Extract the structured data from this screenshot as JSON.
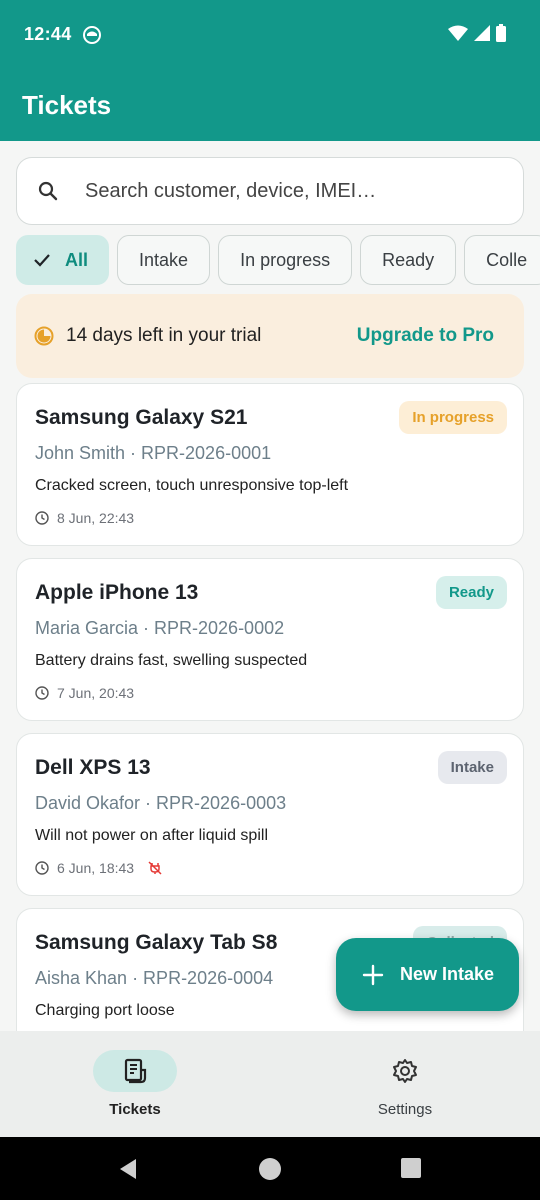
{
  "status_bar": {
    "time": "12:44"
  },
  "app_bar": {
    "title": "Tickets"
  },
  "search": {
    "placeholder": "Search customer, device, IMEI…"
  },
  "filters": [
    {
      "label": "All",
      "selected": true
    },
    {
      "label": "Intake",
      "selected": false
    },
    {
      "label": "In progress",
      "selected": false
    },
    {
      "label": "Ready",
      "selected": false
    },
    {
      "label": "Colle",
      "selected": false
    }
  ],
  "trial_banner": {
    "message": "14 days left in your trial",
    "action": "Upgrade to Pro"
  },
  "tickets": [
    {
      "device": "Samsung Galaxy S21",
      "meta": "John Smith · RPR-2026-0001",
      "issue": "Cracked screen, touch unresponsive top-left",
      "time": "8 Jun, 22:43",
      "status": "In progress",
      "status_kind": "progress",
      "flag": false
    },
    {
      "device": "Apple iPhone 13",
      "meta": "Maria Garcia · RPR-2026-0002",
      "issue": "Battery drains fast, swelling suspected",
      "time": "7 Jun, 20:43",
      "status": "Ready",
      "status_kind": "ready",
      "flag": false
    },
    {
      "device": "Dell XPS 13",
      "meta": "David Okafor · RPR-2026-0003",
      "issue": "Will not power on after liquid spill",
      "time": "6 Jun, 18:43",
      "status": "Intake",
      "status_kind": "intake",
      "flag": true
    },
    {
      "device": "Samsung Galaxy Tab S8",
      "meta": "Aisha Khan · RPR-2026-0004",
      "issue": "Charging port loose",
      "time": "",
      "status": "Collected",
      "status_kind": "collected",
      "flag": false
    }
  ],
  "fab": {
    "label": "New Intake",
    "icon": "plus-icon"
  },
  "bottom_nav": [
    {
      "label": "Tickets",
      "icon": "receipt-icon",
      "active": true
    },
    {
      "label": "Settings",
      "icon": "gear-icon",
      "active": false
    }
  ],
  "colors": {
    "primary": "#12988a",
    "in_progress": "#e6a12a",
    "ready": "#12988a",
    "intake": "#5d6470",
    "warning_flag": "#e53935"
  }
}
